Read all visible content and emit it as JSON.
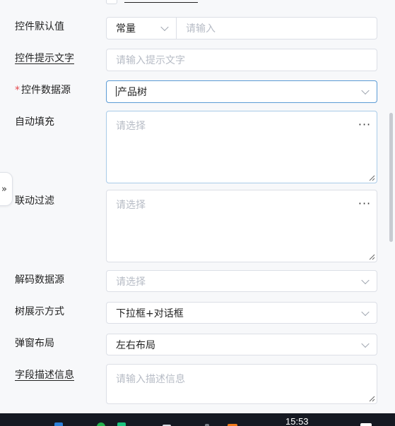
{
  "form": {
    "default_value": {
      "label": "控件默认值",
      "type_value": "常量",
      "placeholder": "请输入"
    },
    "hint_text": {
      "label": "控件提示文字",
      "placeholder": "请输入提示文字"
    },
    "data_source": {
      "required_mark": "*",
      "label": "控件数据源",
      "value": "产品树"
    },
    "autofill": {
      "label": "自动填充",
      "placeholder": "请选择",
      "more": "···"
    },
    "linked_filter": {
      "label": "联动过滤",
      "placeholder": "请选择",
      "more": "···"
    },
    "decode_source": {
      "label": "解码数据源",
      "placeholder": "请选择"
    },
    "tree_display": {
      "label": "树展示方式",
      "value": "下拉框+对话框"
    },
    "dialog_layout": {
      "label": "弹窗布局",
      "value": "左右布局"
    },
    "field_desc": {
      "label": "字段描述信息",
      "placeholder": "请输入描述信息"
    }
  },
  "side_toggle": "»",
  "taskbar": {
    "time": "15:53"
  },
  "colors": {
    "accent_border": "#5b9bd5",
    "required": "#e5484d",
    "taskbar": "#151922"
  }
}
